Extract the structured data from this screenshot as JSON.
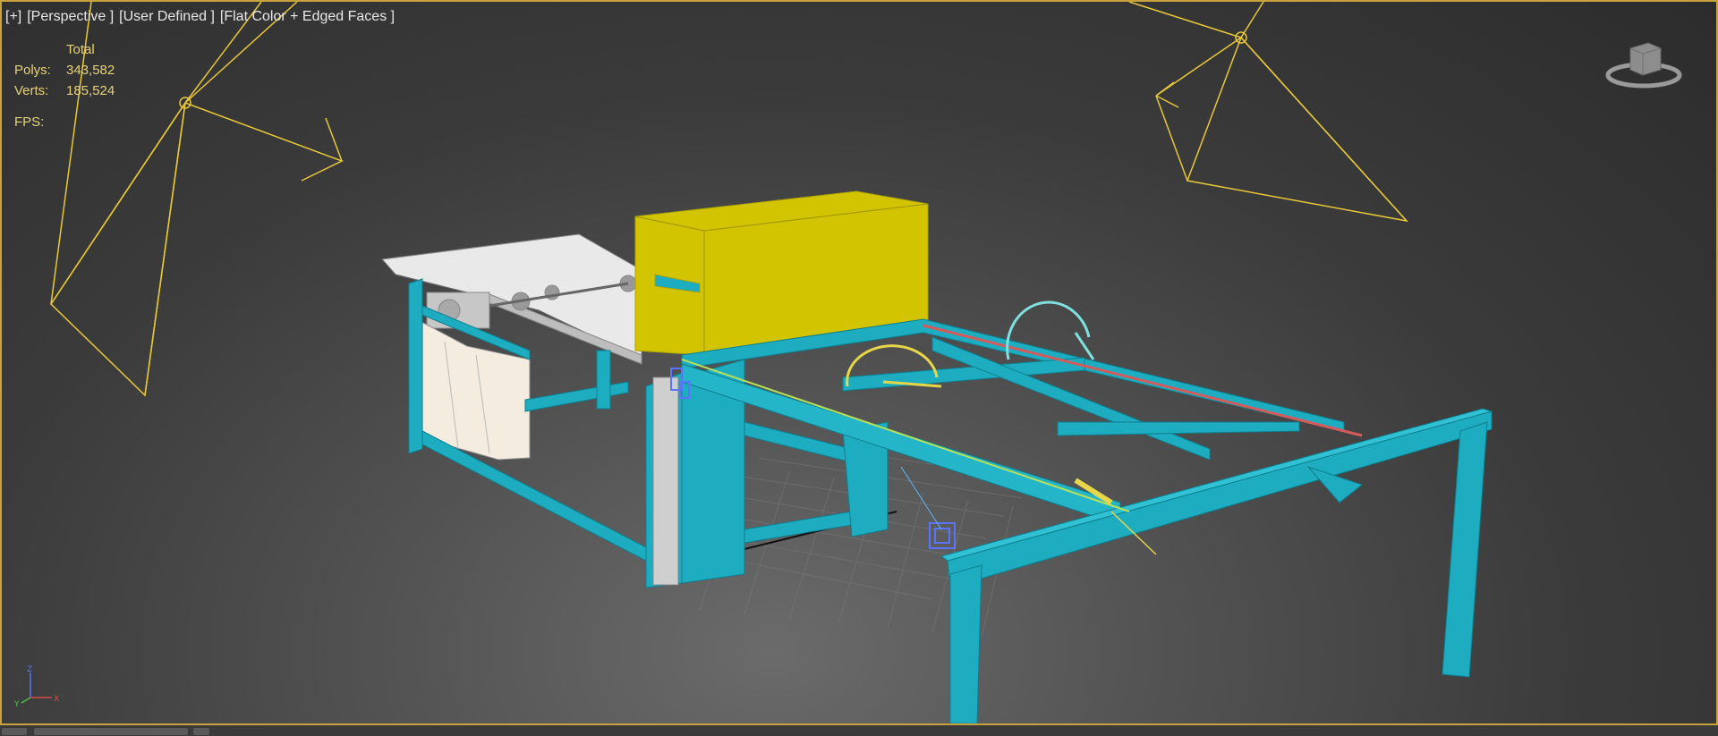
{
  "viewport": {
    "labels": [
      "[+]",
      "[Perspective ]",
      "[User Defined ]",
      "[Flat Color + Edged Faces ]"
    ]
  },
  "stats": {
    "header": "Total",
    "polys_label": "Polys:",
    "polys_value": "343,582",
    "verts_label": "Verts:",
    "verts_value": "185,524",
    "fps_label": "FPS:"
  },
  "viewcube": {
    "icon": "viewcube-icon"
  },
  "axis": {
    "x": "X",
    "y": "Y",
    "z": "Z"
  },
  "colors": {
    "frame": "#1eadc0",
    "yellow_box": "#d2c400",
    "light_gizmo": "#e8c83a",
    "viewport_border": "#c8a23a",
    "stats_text": "#e6d27a"
  }
}
